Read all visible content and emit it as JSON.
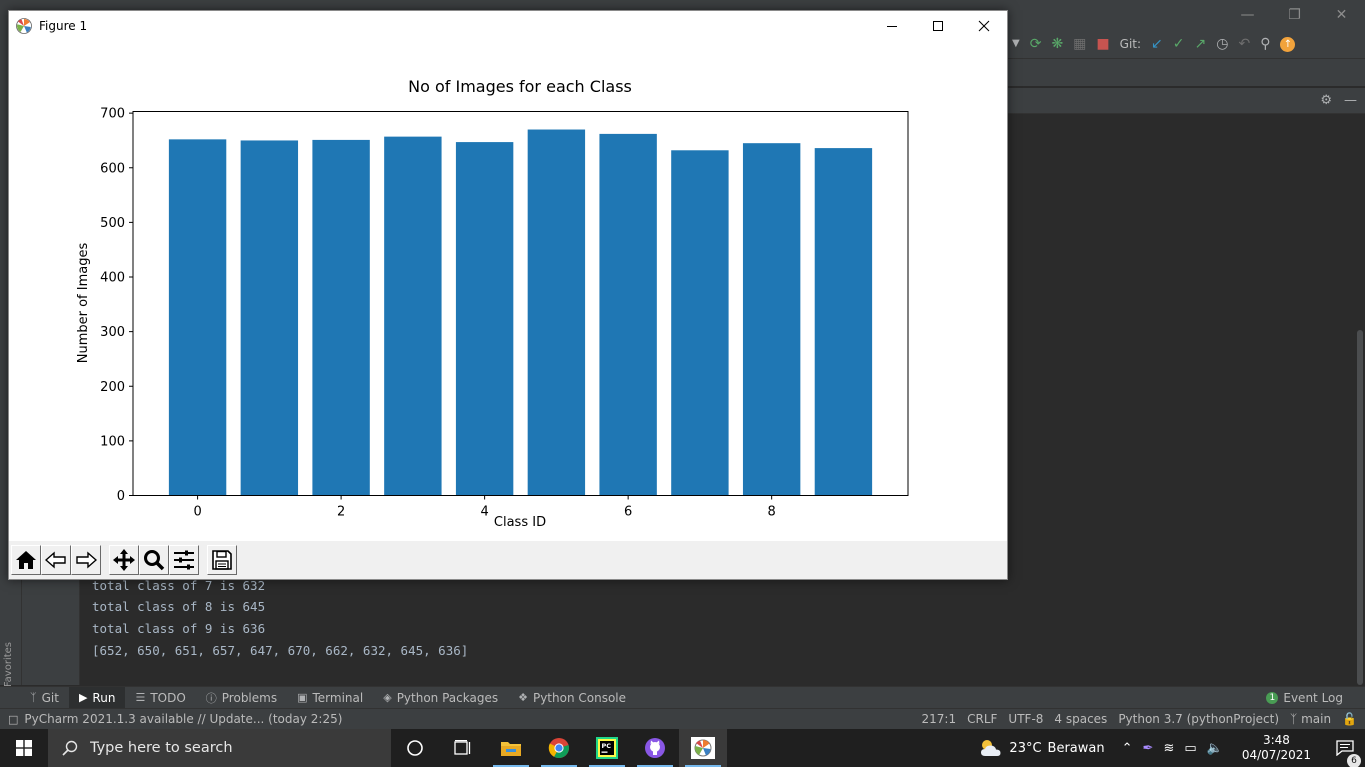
{
  "figure": {
    "window_title": "Figure 1",
    "controls": [
      "minimize-icon",
      "maximize-icon",
      "close-icon"
    ],
    "toolbar": [
      "home-icon",
      "back-icon",
      "forward-icon",
      "pan-icon",
      "zoom-icon",
      "configure-subplots-icon",
      "save-icon"
    ]
  },
  "chart_data": {
    "type": "bar",
    "title": "No of Images for each Class",
    "xlabel": "Class ID",
    "ylabel": "Number of Images",
    "categories": [
      0,
      1,
      2,
      3,
      4,
      5,
      6,
      7,
      8,
      9
    ],
    "values": [
      652,
      650,
      651,
      657,
      647,
      670,
      662,
      632,
      645,
      636
    ],
    "xticks": [
      0,
      2,
      4,
      6,
      8
    ],
    "yticks": [
      0,
      100,
      200,
      300,
      400,
      500,
      600,
      700
    ],
    "xlim": [
      -0.9,
      9.9
    ],
    "ylim": [
      0,
      703
    ],
    "bar_color": "#1f77b4",
    "grid": false
  },
  "ide": {
    "git_label": "Git:",
    "console_lines": [
      "total class of 7 is 632",
      "total class of 8 is 645",
      "total class of 9 is 636",
      "[652, 650, 651, 657, 647, 670, 662, 632, 645, 636]"
    ],
    "favorites_label": "Favorites",
    "tool_tabs": [
      {
        "icon": "git-branch-icon",
        "label": "Git"
      },
      {
        "icon": "run-icon",
        "label": "Run"
      },
      {
        "icon": "todo-icon",
        "label": "TODO"
      },
      {
        "icon": "problems-icon",
        "label": "Problems"
      },
      {
        "icon": "terminal-icon",
        "label": "Terminal"
      },
      {
        "icon": "packages-icon",
        "label": "Python Packages"
      },
      {
        "icon": "python-console-icon",
        "label": "Python Console"
      }
    ],
    "event_log": {
      "count": "1",
      "label": "Event Log"
    },
    "status_message": "PyCharm 2021.1.3 available // Update... (today 2:25)",
    "status_right": {
      "position": "217:1",
      "line_sep": "CRLF",
      "encoding": "UTF-8",
      "indent": "4 spaces",
      "interpreter": "Python 3.7 (pythonProject)",
      "branch": "main"
    }
  },
  "taskbar": {
    "search_placeholder": "Type here to search",
    "weather_temp": "23°C",
    "weather_text": "Berawan",
    "time": "3:48",
    "date": "04/07/2021",
    "notification_count": "6"
  },
  "colors": {
    "accent": "#1f77b4",
    "ide_bg": "#2b2b2b",
    "taskbar_bg": "#1f1f1f"
  }
}
